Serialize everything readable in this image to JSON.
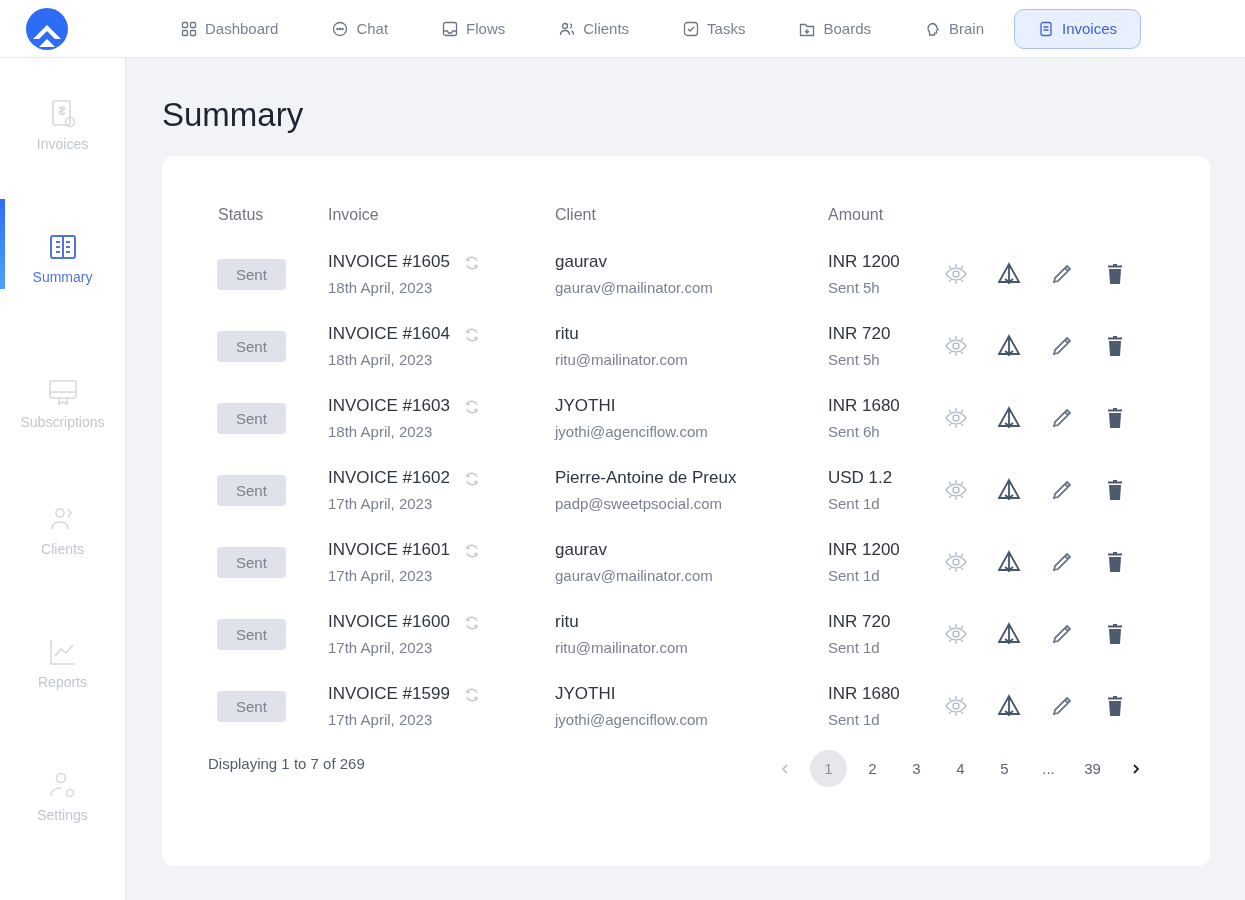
{
  "top_nav": [
    {
      "label": "Dashboard",
      "selected": false
    },
    {
      "label": "Chat",
      "selected": false
    },
    {
      "label": "Flows",
      "selected": false
    },
    {
      "label": "Clients",
      "selected": false
    },
    {
      "label": "Tasks",
      "selected": false
    },
    {
      "label": "Boards",
      "selected": false
    },
    {
      "label": "Brain",
      "selected": false
    },
    {
      "label": "Invoices",
      "selected": true
    }
  ],
  "sidebar": {
    "items": [
      {
        "label": "Invoices",
        "selected": false
      },
      {
        "label": "Summary",
        "selected": true
      },
      {
        "label": "Subscriptions",
        "selected": false
      },
      {
        "label": "Clients",
        "selected": false
      },
      {
        "label": "Reports",
        "selected": false
      },
      {
        "label": "Settings",
        "selected": false
      }
    ]
  },
  "page_title": "Summary",
  "table": {
    "columns": [
      "Status",
      "Invoice",
      "Client",
      "Amount"
    ],
    "rows": [
      {
        "status": "Sent",
        "invoice": "INVOICE #1605",
        "date": "18th April, 2023",
        "client": "gaurav",
        "email": "gaurav@mailinator.com",
        "amount": "INR 1200",
        "sent": "Sent 5h"
      },
      {
        "status": "Sent",
        "invoice": "INVOICE #1604",
        "date": "18th April, 2023",
        "client": "ritu",
        "email": "ritu@mailinator.com",
        "amount": "INR 720",
        "sent": "Sent 5h"
      },
      {
        "status": "Sent",
        "invoice": "INVOICE #1603",
        "date": "18th April, 2023",
        "client": "JYOTHI",
        "email": "jyothi@agenciflow.com",
        "amount": "INR 1680",
        "sent": "Sent 6h"
      },
      {
        "status": "Sent",
        "invoice": "INVOICE #1602",
        "date": "17th April, 2023",
        "client": "Pierre-Antoine de Preux",
        "email": "padp@sweetpsocial.com",
        "amount": "USD 1.2",
        "sent": "Sent 1d"
      },
      {
        "status": "Sent",
        "invoice": "INVOICE #1601",
        "date": "17th April, 2023",
        "client": "gaurav",
        "email": "gaurav@mailinator.com",
        "amount": "INR 1200",
        "sent": "Sent 1d"
      },
      {
        "status": "Sent",
        "invoice": "INVOICE #1600",
        "date": "17th April, 2023",
        "client": "ritu",
        "email": "ritu@mailinator.com",
        "amount": "INR 720",
        "sent": "Sent 1d"
      },
      {
        "status": "Sent",
        "invoice": "INVOICE #1599",
        "date": "17th April, 2023",
        "client": "JYOTHI",
        "email": "jyothi@agenciflow.com",
        "amount": "INR 1680",
        "sent": "Sent 1d"
      }
    ]
  },
  "footer": {
    "summary": "Displaying 1 to 7 of 269",
    "pagination": {
      "prev_disabled": true,
      "next_disabled": false,
      "pages": [
        {
          "label": "1",
          "selected": true
        },
        {
          "label": "2",
          "selected": false
        },
        {
          "label": "3",
          "selected": false
        },
        {
          "label": "4",
          "selected": false
        },
        {
          "label": "5",
          "selected": false
        },
        {
          "label": "...",
          "selected": false
        },
        {
          "label": "39",
          "selected": false
        }
      ]
    }
  }
}
